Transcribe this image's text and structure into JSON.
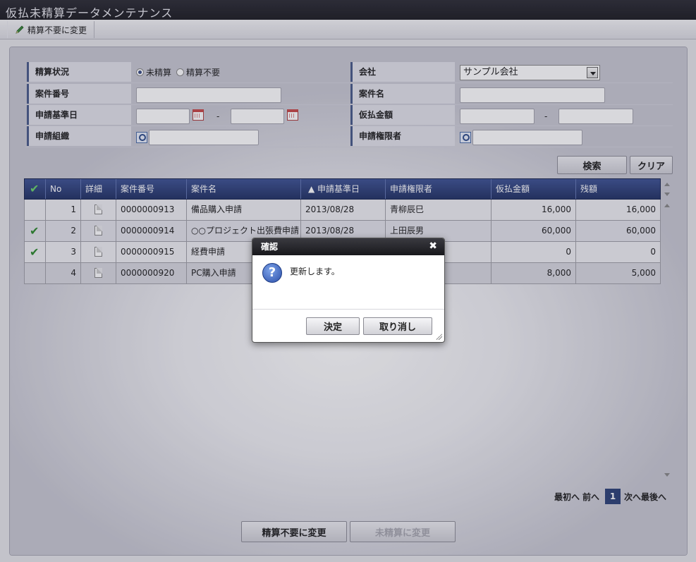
{
  "window": {
    "title": "仮払未精算データメンテナンス"
  },
  "toolbar": {
    "settle_unneeded_label": "精算不要に変更"
  },
  "search": {
    "status_label": "精算状況",
    "status_options": [
      {
        "label": "未精算",
        "selected": true
      },
      {
        "label": "精算不要",
        "selected": false
      }
    ],
    "company_label": "会社",
    "company_value": "サンプル会社",
    "case_no_label": "案件番号",
    "case_name_label": "案件名",
    "apply_date_label": "申請基準日",
    "advance_amount_label": "仮払金額",
    "org_label": "申請組織",
    "authority_label": "申請権限者",
    "range_sep": "-",
    "search_button": "検索",
    "clear_button": "クリア"
  },
  "grid": {
    "columns": [
      "No",
      "詳細",
      "案件番号",
      "案件名",
      "▲ 申請基準日",
      "申請権限者",
      "仮払金額",
      "残額"
    ],
    "rows": [
      {
        "checked": false,
        "no": "1",
        "case_no": "0000000913",
        "case_name": "備品購入申請",
        "date": "2013/08/28",
        "applicant": "青柳辰巳",
        "amount": "16,000",
        "balance": "16,000"
      },
      {
        "checked": true,
        "no": "2",
        "case_no": "0000000914",
        "case_name": "○○プロジェクト出張費申請",
        "date": "2013/08/28",
        "applicant": "上田辰男",
        "amount": "60,000",
        "balance": "60,000"
      },
      {
        "checked": true,
        "no": "3",
        "case_no": "0000000915",
        "case_name": "経費申請",
        "date": "",
        "applicant": "",
        "amount": "0",
        "balance": "0"
      },
      {
        "checked": false,
        "no": "4",
        "case_no": "0000000920",
        "case_name": "PC購入申請",
        "date": "",
        "applicant": "",
        "amount": "8,000",
        "balance": "5,000"
      }
    ],
    "check_glyph": "✔"
  },
  "pager": {
    "first": "最初へ",
    "prev": "前へ",
    "current": "1",
    "next": "次へ",
    "last": "最後へ"
  },
  "bottom": {
    "settle_unneeded_button": "精算不要に変更",
    "unsettled_button": "未精算に変更"
  },
  "dialog": {
    "title": "確認",
    "message": "更新します。",
    "ok_button": "決定",
    "cancel_button": "取り消し",
    "close_glyph": "✖",
    "question_glyph": "?"
  },
  "colors": {
    "header_navy": "#2f4380",
    "check_green": "#2e8a2e",
    "dialog_title_bg": "#202024"
  }
}
